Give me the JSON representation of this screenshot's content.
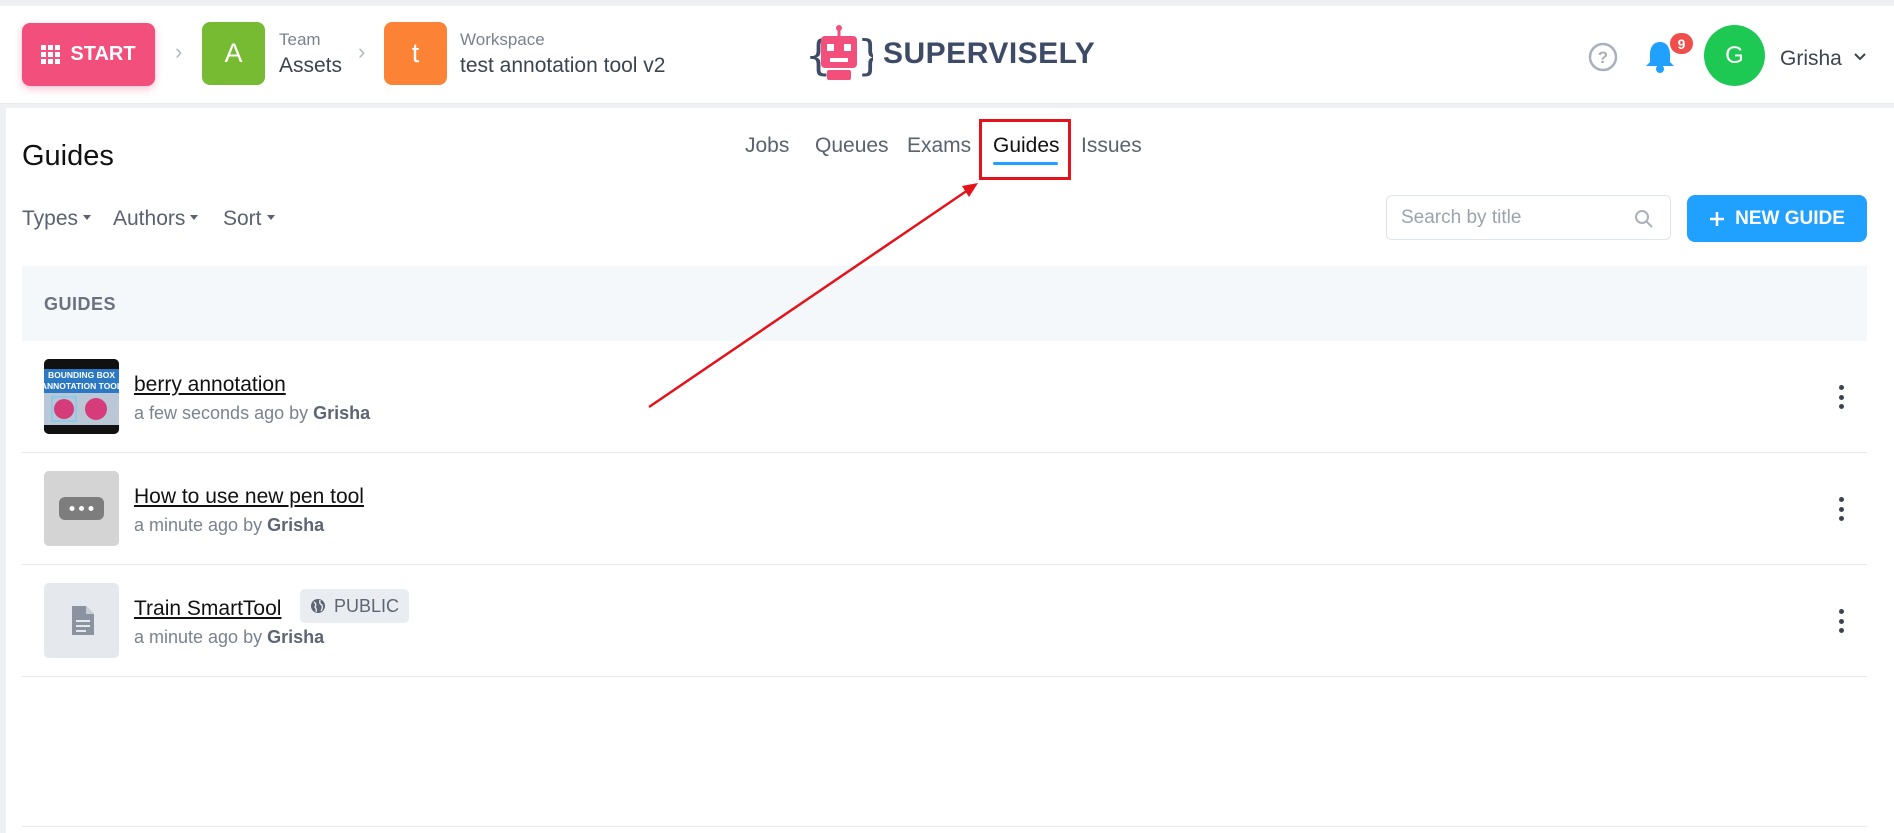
{
  "header": {
    "start_label": "START",
    "team": {
      "avatar_letter": "A",
      "label": "Team",
      "name": "Assets",
      "color": "#76bb32"
    },
    "workspace": {
      "avatar_letter": "t",
      "label": "Workspace",
      "name": "test annotation tool v2",
      "color": "#fc8336"
    },
    "logo_text": "SUPERVISELY",
    "notifications_count": "9",
    "user": {
      "avatar_letter": "G",
      "name": "Grisha"
    }
  },
  "page": {
    "title": "Guides",
    "tabs": [
      {
        "label": "Jobs",
        "active": false
      },
      {
        "label": "Queues",
        "active": false
      },
      {
        "label": "Exams",
        "active": false
      },
      {
        "label": "Guides",
        "active": true
      },
      {
        "label": "Issues",
        "active": false
      }
    ],
    "filters": {
      "types": "Types",
      "authors": "Authors",
      "sort": "Sort"
    },
    "search": {
      "placeholder": "Search by title"
    },
    "new_guide_label": "NEW GUIDE",
    "list_header": "GUIDES"
  },
  "guides": [
    {
      "title": "berry annotation",
      "time": "a few seconds ago by",
      "author": "Grisha",
      "thumb": "video",
      "thumb_text": [
        "BOUNDING BOX",
        "ANNOTATION TOOL"
      ]
    },
    {
      "title": "How to use new pen tool",
      "time": "a minute ago by",
      "author": "Grisha",
      "thumb": "video-placeholder"
    },
    {
      "title": "Train SmartTool",
      "time": "a minute ago by",
      "author": "Grisha",
      "thumb": "document",
      "badge": "PUBLIC"
    }
  ],
  "colors": {
    "accent": "#20a0ff",
    "start": "#f24f7c",
    "highlight": "#e4131b"
  }
}
